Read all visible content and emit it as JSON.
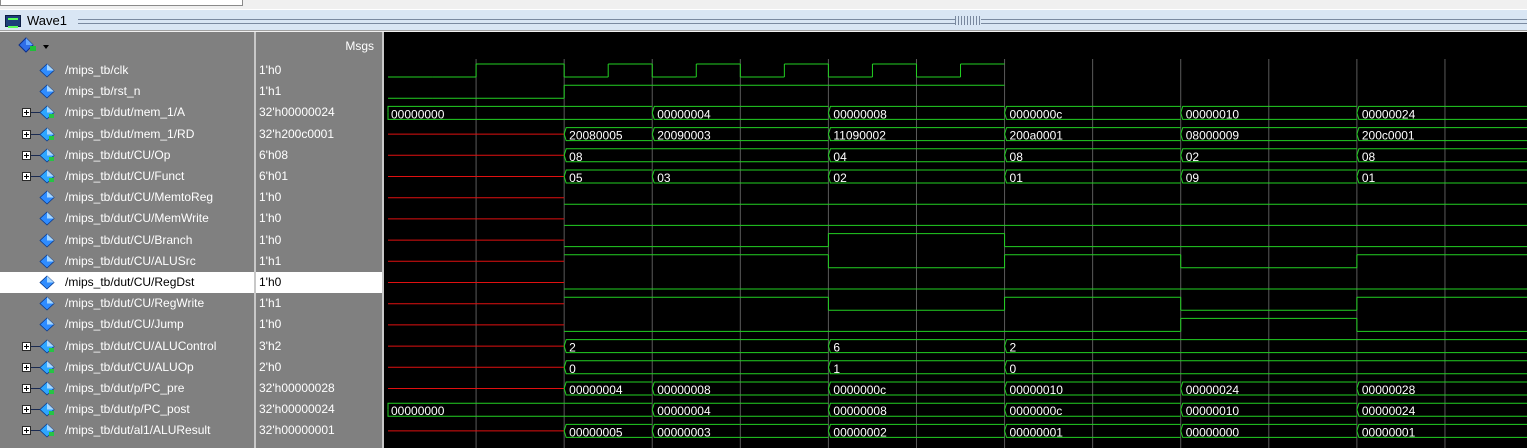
{
  "window": {
    "title": "Wave1"
  },
  "header": {
    "msgs_label": "Msgs"
  },
  "colors": {
    "wave": "#22d022",
    "undefined": "#e01010",
    "grid": "#5a5a5a"
  },
  "icons": {
    "header": "signal-diamond-menu-icon",
    "signal": "signal-diamond-icon",
    "expand": "expand-plus-icon"
  },
  "signals": [
    {
      "name": "/mips_tb/clk",
      "value": "1'h0",
      "expandable": false,
      "type": "bit"
    },
    {
      "name": "/mips_tb/rst_n",
      "value": "1'h1",
      "expandable": false,
      "type": "bit"
    },
    {
      "name": "/mips_tb/dut/mem_1/A",
      "value": "32'h00000024",
      "expandable": true,
      "type": "bus"
    },
    {
      "name": "/mips_tb/dut/mem_1/RD",
      "value": "32'h200c0001",
      "expandable": true,
      "type": "bus"
    },
    {
      "name": "/mips_tb/dut/CU/Op",
      "value": "6'h08",
      "expandable": true,
      "type": "bus"
    },
    {
      "name": "/mips_tb/dut/CU/Funct",
      "value": "6'h01",
      "expandable": true,
      "type": "bus"
    },
    {
      "name": "/mips_tb/dut/CU/MemtoReg",
      "value": "1'h0",
      "expandable": false,
      "type": "bit"
    },
    {
      "name": "/mips_tb/dut/CU/MemWrite",
      "value": "1'h0",
      "expandable": false,
      "type": "bit"
    },
    {
      "name": "/mips_tb/dut/CU/Branch",
      "value": "1'h0",
      "expandable": false,
      "type": "bit"
    },
    {
      "name": "/mips_tb/dut/CU/ALUSrc",
      "value": "1'h1",
      "expandable": false,
      "type": "bit"
    },
    {
      "name": "/mips_tb/dut/CU/RegDst",
      "value": "1'h0",
      "expandable": false,
      "type": "bit",
      "selected": true
    },
    {
      "name": "/mips_tb/dut/CU/RegWrite",
      "value": "1'h1",
      "expandable": false,
      "type": "bit"
    },
    {
      "name": "/mips_tb/dut/CU/Jump",
      "value": "1'h0",
      "expandable": false,
      "type": "bit"
    },
    {
      "name": "/mips_tb/dut/CU/ALUControl",
      "value": "3'h2",
      "expandable": true,
      "type": "bus"
    },
    {
      "name": "/mips_tb/dut/CU/ALUOp",
      "value": "2'h0",
      "expandable": true,
      "type": "bus"
    },
    {
      "name": "/mips_tb/dut/p/PC_pre",
      "value": "32'h00000028",
      "expandable": true,
      "type": "bus"
    },
    {
      "name": "/mips_tb/dut/p/PC_post",
      "value": "32'h00000024",
      "expandable": true,
      "type": "bus"
    },
    {
      "name": "/mips_tb/dut/al1/ALUResult",
      "value": "32'h00000001",
      "expandable": true,
      "type": "bus"
    }
  ],
  "waves": {
    "clk": {
      "segments": [
        [
          "u",
          0,
          1
        ],
        [
          "0",
          1,
          2
        ],
        [
          "1",
          2,
          4
        ],
        [
          "0",
          4,
          5
        ],
        [
          "1",
          5,
          6
        ],
        [
          "0",
          6,
          7
        ],
        [
          "1",
          7,
          8
        ],
        [
          "0",
          8,
          9
        ],
        [
          "1",
          9,
          10
        ],
        [
          "0",
          10,
          11
        ],
        [
          "1",
          11,
          12
        ],
        [
          "0",
          12,
          13
        ],
        [
          "1",
          13,
          14
        ]
      ]
    },
    "rst_n": {
      "segments": [
        [
          "u",
          0,
          1
        ],
        [
          "0",
          1,
          4
        ],
        [
          "1",
          4,
          14
        ]
      ]
    },
    "mem_1_A": {
      "segments": [
        [
          "00000000",
          0,
          6
        ],
        [
          "00000004",
          6,
          10
        ],
        [
          "00000008",
          10,
          14
        ]
      ],
      "extra": [
        [
          "0000000c",
          14,
          18
        ],
        [
          "00000010",
          18,
          22
        ],
        [
          "00000024",
          22,
          26
        ]
      ]
    },
    "mem_1_RD": {
      "segments": [
        [
          "x",
          0,
          4
        ],
        [
          "20080005",
          4,
          6
        ],
        [
          "20090003",
          6,
          10
        ],
        [
          "11090002",
          10,
          14
        ],
        [
          "200a0001",
          14,
          18
        ],
        [
          "08000009",
          18,
          22
        ],
        [
          "200c0001",
          22,
          26
        ]
      ]
    },
    "Op": {
      "segments": [
        [
          "x",
          0,
          4
        ],
        [
          "08",
          4,
          10
        ],
        [
          "04",
          10,
          14
        ],
        [
          "08",
          14,
          18
        ],
        [
          "02",
          18,
          22
        ],
        [
          "08",
          22,
          26
        ]
      ]
    },
    "Funct": {
      "segments": [
        [
          "x",
          0,
          4
        ],
        [
          "05",
          4,
          6
        ],
        [
          "03",
          6,
          10
        ],
        [
          "02",
          10,
          14
        ],
        [
          "01",
          14,
          18
        ],
        [
          "09",
          18,
          22
        ],
        [
          "01",
          22,
          26
        ]
      ]
    },
    "MemtoReg": {
      "segments": [
        [
          "x",
          0,
          4
        ],
        [
          "0",
          4,
          26
        ]
      ]
    },
    "MemWrite": {
      "segments": [
        [
          "x",
          0,
          4
        ],
        [
          "0",
          4,
          26
        ]
      ]
    },
    "Branch": {
      "segments": [
        [
          "x",
          0,
          4
        ],
        [
          "0",
          4,
          10
        ],
        [
          "1",
          10,
          14
        ],
        [
          "0",
          14,
          26
        ]
      ]
    },
    "ALUSrc": {
      "segments": [
        [
          "x",
          0,
          4
        ],
        [
          "1",
          4,
          10
        ],
        [
          "0",
          10,
          14
        ],
        [
          "1",
          14,
          18
        ],
        [
          "0",
          18,
          22
        ],
        [
          "1",
          22,
          26
        ]
      ]
    },
    "RegDst": {
      "segments": [
        [
          "x",
          0,
          4
        ],
        [
          "0",
          4,
          26
        ]
      ]
    },
    "RegWrite": {
      "segments": [
        [
          "x",
          0,
          4
        ],
        [
          "1",
          4,
          10
        ],
        [
          "0",
          10,
          14
        ],
        [
          "1",
          14,
          18
        ],
        [
          "0",
          18,
          22
        ],
        [
          "1",
          22,
          26
        ]
      ]
    },
    "Jump": {
      "segments": [
        [
          "x",
          0,
          4
        ],
        [
          "0",
          4,
          18
        ],
        [
          "1",
          18,
          22
        ],
        [
          "0",
          22,
          26
        ]
      ]
    },
    "ALUControl": {
      "segments": [
        [
          "x",
          0,
          4
        ],
        [
          "2",
          4,
          10
        ],
        [
          "6",
          10,
          14
        ],
        [
          "2",
          14,
          26
        ]
      ]
    },
    "ALUOp": {
      "segments": [
        [
          "x",
          0,
          4
        ],
        [
          "0",
          4,
          10
        ],
        [
          "1",
          10,
          14
        ],
        [
          "0",
          14,
          26
        ]
      ]
    },
    "PC_pre": {
      "segments": [
        [
          "x",
          0,
          4
        ],
        [
          "00000004",
          4,
          6
        ],
        [
          "00000008",
          6,
          10
        ],
        [
          "0000000c",
          10,
          14
        ],
        [
          "00000010",
          14,
          18
        ],
        [
          "00000024",
          18,
          22
        ],
        [
          "00000028",
          22,
          26
        ]
      ]
    },
    "PC_post": {
      "segments": [
        [
          "00000000",
          0,
          6
        ],
        [
          "00000004",
          6,
          10
        ],
        [
          "00000008",
          10,
          14
        ],
        [
          "0000000c",
          14,
          18
        ],
        [
          "00000010",
          18,
          22
        ],
        [
          "00000024",
          22,
          26
        ]
      ]
    },
    "ALUResult": {
      "segments": [
        [
          "x",
          0,
          4
        ],
        [
          "00000005",
          4,
          6
        ],
        [
          "00000003",
          6,
          10
        ],
        [
          "00000002",
          10,
          14
        ],
        [
          "00000001",
          14,
          18
        ],
        [
          "00000000",
          18,
          22
        ],
        [
          "00000001",
          22,
          26
        ]
      ]
    }
  }
}
